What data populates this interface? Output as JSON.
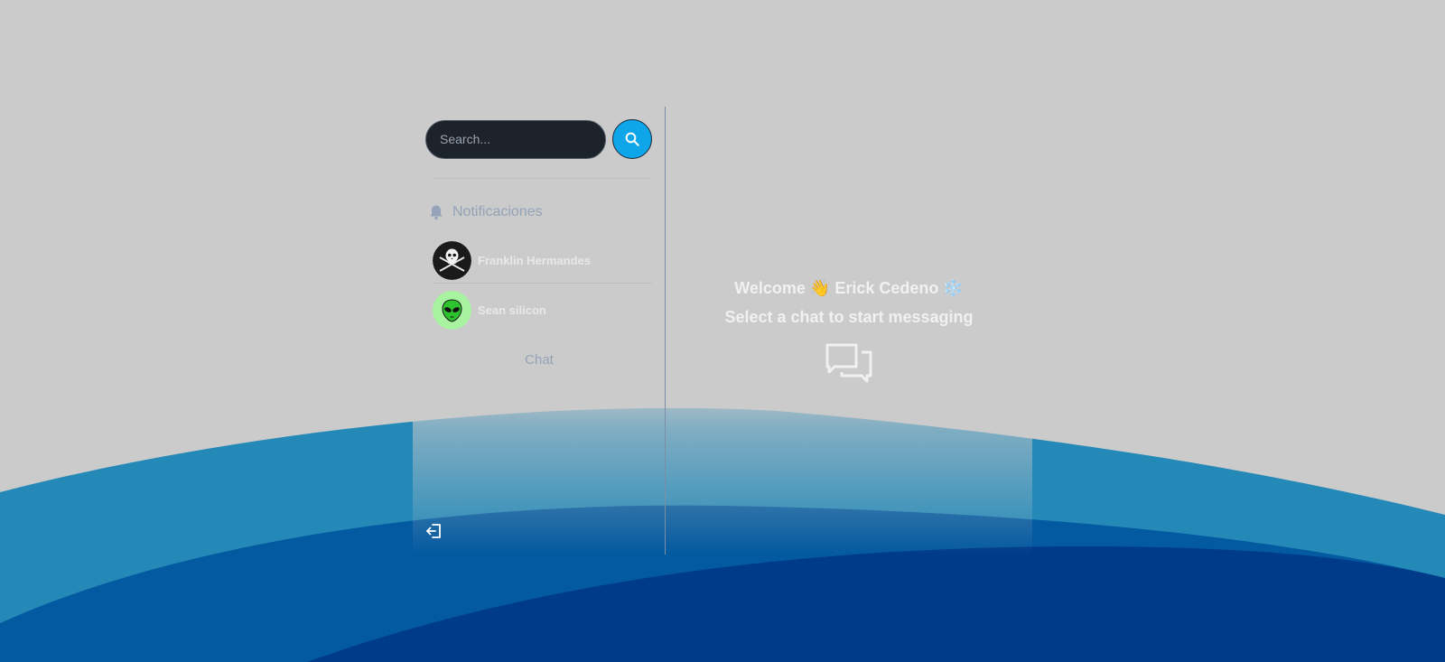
{
  "search": {
    "placeholder": "Search..."
  },
  "sidebar": {
    "notifications_label": "Notificaciones",
    "conversations": [
      {
        "name": "Franklin Hermandes",
        "avatar_icon": "pirate-skull-icon"
      },
      {
        "name": "Sean silicon",
        "avatar_icon": "alien-icon"
      }
    ],
    "chat_label": "Chat",
    "logout_icon": "logout-icon"
  },
  "main": {
    "welcome_text": "Welcome 👋 Erick Cedeno ❄️",
    "subtitle": "Select a chat to start messaging",
    "icon": "chat-bubbles-icon"
  },
  "colors": {
    "background": "#cbcbcb",
    "search_bg": "#1d232a",
    "accent": "#0ea5e9",
    "wave_light": "#2589b8",
    "wave_mid": "#045aa0",
    "wave_dark": "#003b8a"
  }
}
